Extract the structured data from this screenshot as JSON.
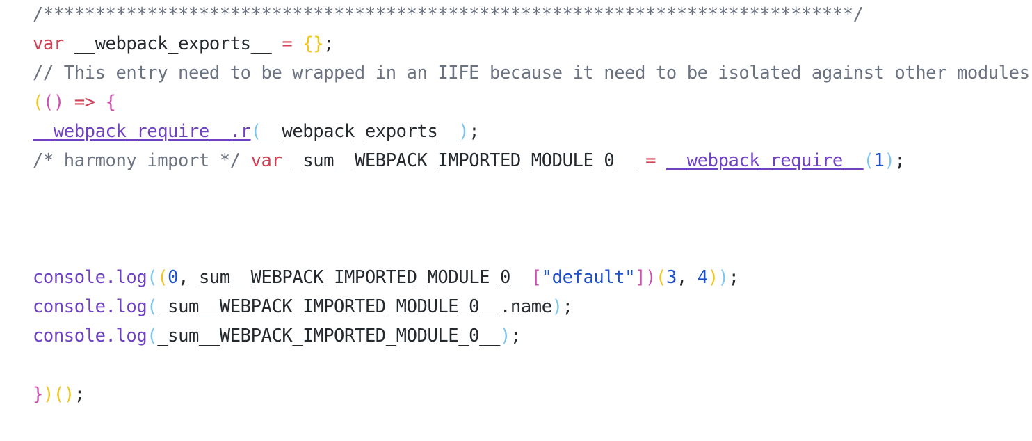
{
  "editor": {
    "language": "javascript",
    "background": "#ffffff",
    "font_size_px": 25.5,
    "line_height_px": 42,
    "theme_colors": {
      "comment": "#6b7280",
      "keyword": "#d14054",
      "operator": "#d14054",
      "plain_text": "#24292e",
      "function": "#6f42c1",
      "module_ref": "#6f42c1",
      "bracket_yellow": "#f2c41e",
      "bracket_blue": "#7cc5f0",
      "bracket_magenta": "#cf4fb0",
      "number": "#1e50c8",
      "string": "#1e50c8"
    }
  },
  "code": {
    "lines": [
      {
        "id": "line-1-banner-comment",
        "tokens": [
          {
            "t": "/******************************************************************************/",
            "k": "comment"
          }
        ]
      },
      {
        "id": "line-2-webpack-exports-decl",
        "tokens": [
          {
            "t": "var",
            "k": "keyword"
          },
          {
            "t": " ",
            "k": "plain"
          },
          {
            "t": "__webpack_exports__",
            "k": "plain"
          },
          {
            "t": " ",
            "k": "plain"
          },
          {
            "t": "=",
            "k": "operator"
          },
          {
            "t": " ",
            "k": "plain"
          },
          {
            "t": "{}",
            "k": "brace-y"
          },
          {
            "t": ";",
            "k": "punct"
          }
        ]
      },
      {
        "id": "line-3-iife-comment",
        "tokens": [
          {
            "t": "// This entry need to be wrapped in an IIFE because it need to be isolated against other modules in the chunk.",
            "k": "comment"
          }
        ]
      },
      {
        "id": "line-4-iife-open",
        "tokens": [
          {
            "t": "(",
            "k": "paren-y"
          },
          {
            "t": "()",
            "k": "paren-m"
          },
          {
            "t": " ",
            "k": "plain"
          },
          {
            "t": "=>",
            "k": "operator"
          },
          {
            "t": " ",
            "k": "plain"
          },
          {
            "t": "{",
            "k": "brace-m"
          }
        ]
      },
      {
        "id": "line-5-require-r",
        "tokens": [
          {
            "t": "__webpack_require__.r",
            "k": "module"
          },
          {
            "t": "(",
            "k": "paren-b"
          },
          {
            "t": "__webpack_exports__",
            "k": "plain"
          },
          {
            "t": ")",
            "k": "paren-b"
          },
          {
            "t": ";",
            "k": "punct"
          }
        ]
      },
      {
        "id": "line-6-harmony-import",
        "tokens": [
          {
            "t": "/* harmony import */",
            "k": "comment"
          },
          {
            "t": " ",
            "k": "plain"
          },
          {
            "t": "var",
            "k": "keyword"
          },
          {
            "t": " ",
            "k": "plain"
          },
          {
            "t": "_sum__WEBPACK_IMPORTED_MODULE_0__",
            "k": "plain"
          },
          {
            "t": " ",
            "k": "plain"
          },
          {
            "t": "=",
            "k": "operator"
          },
          {
            "t": " ",
            "k": "plain"
          },
          {
            "t": "__webpack_require__",
            "k": "module"
          },
          {
            "t": "(",
            "k": "paren-b"
          },
          {
            "t": "1",
            "k": "number"
          },
          {
            "t": ")",
            "k": "paren-b"
          },
          {
            "t": ";",
            "k": "punct"
          }
        ]
      },
      {
        "id": "line-7-blank",
        "tokens": []
      },
      {
        "id": "line-8-blank",
        "tokens": []
      },
      {
        "id": "line-9-blank",
        "tokens": []
      },
      {
        "id": "line-10-console-log-default-call",
        "tokens": [
          {
            "t": "console.log",
            "k": "func"
          },
          {
            "t": "(",
            "k": "paren-b"
          },
          {
            "t": "(",
            "k": "paren-y"
          },
          {
            "t": "0",
            "k": "number"
          },
          {
            "t": ",",
            "k": "punct"
          },
          {
            "t": "_sum__WEBPACK_IMPORTED_MODULE_0__",
            "k": "plain"
          },
          {
            "t": "[",
            "k": "bracket-m"
          },
          {
            "t": "\"default\"",
            "k": "string"
          },
          {
            "t": "]",
            "k": "bracket-m"
          },
          {
            "t": ")",
            "k": "paren-m"
          },
          {
            "t": "(",
            "k": "paren-y"
          },
          {
            "t": "3",
            "k": "number"
          },
          {
            "t": ",",
            "k": "punct"
          },
          {
            "t": " ",
            "k": "plain"
          },
          {
            "t": "4",
            "k": "number"
          },
          {
            "t": ")",
            "k": "paren-y"
          },
          {
            "t": ")",
            "k": "paren-b"
          },
          {
            "t": ";",
            "k": "punct"
          }
        ]
      },
      {
        "id": "line-11-console-log-name",
        "tokens": [
          {
            "t": "console.log",
            "k": "func"
          },
          {
            "t": "(",
            "k": "paren-b"
          },
          {
            "t": "_sum__WEBPACK_IMPORTED_MODULE_0__.name",
            "k": "plain"
          },
          {
            "t": ")",
            "k": "paren-b"
          },
          {
            "t": ";",
            "k": "punct"
          }
        ]
      },
      {
        "id": "line-12-console-log-module",
        "tokens": [
          {
            "t": "console.log",
            "k": "func"
          },
          {
            "t": "(",
            "k": "paren-b"
          },
          {
            "t": "_sum__WEBPACK_IMPORTED_MODULE_0__",
            "k": "plain"
          },
          {
            "t": ")",
            "k": "paren-b"
          },
          {
            "t": ";",
            "k": "punct"
          }
        ]
      },
      {
        "id": "line-13-blank",
        "tokens": []
      },
      {
        "id": "line-14-iife-close",
        "tokens": [
          {
            "t": "}",
            "k": "brace-m"
          },
          {
            "t": ")",
            "k": "paren-y"
          },
          {
            "t": "()",
            "k": "paren-y"
          },
          {
            "t": ";",
            "k": "punct"
          }
        ]
      }
    ]
  }
}
